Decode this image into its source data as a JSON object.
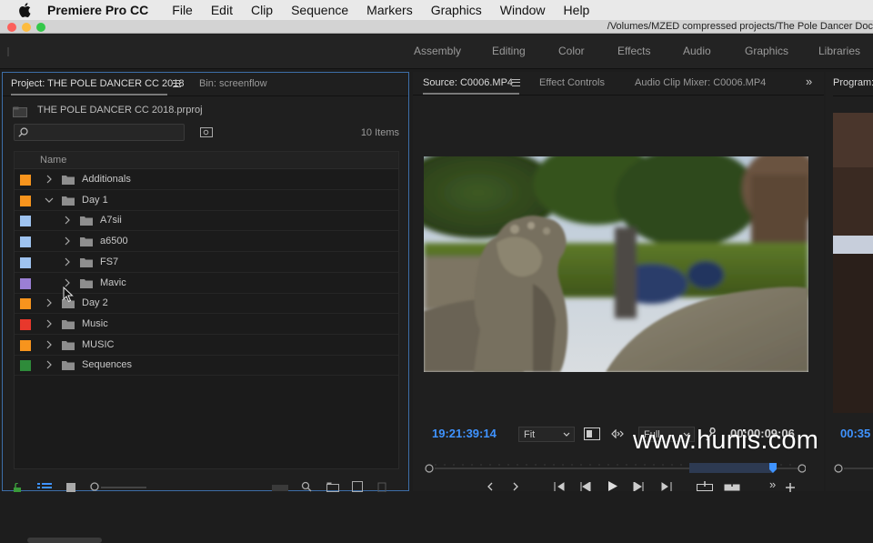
{
  "menubar": {
    "app_name": "Premiere Pro CC",
    "items": [
      "File",
      "Edit",
      "Clip",
      "Sequence",
      "Markers",
      "Graphics",
      "Window",
      "Help"
    ]
  },
  "window": {
    "title": "/Volumes/MZED compressed projects/The Pole Dancer Doc"
  },
  "workspaces": [
    "Assembly",
    "Editing",
    "Color",
    "Effects",
    "Audio",
    "Graphics",
    "Libraries"
  ],
  "project_panel": {
    "tab_active": "Project: THE POLE DANCER CC 2018",
    "tab_bin": "Bin: screenflow",
    "project_file": "THE POLE DANCER CC 2018.prproj",
    "search_value": "",
    "items_count": "10 Items",
    "column_name": "Name",
    "rows": [
      {
        "label": "Additionals",
        "color": "#f7941d",
        "expanded": false,
        "indent": 0
      },
      {
        "label": "Day 1",
        "color": "#f7941d",
        "expanded": true,
        "indent": 0
      },
      {
        "label": "A7sii",
        "color": "#9ec3f0",
        "expanded": false,
        "indent": 1
      },
      {
        "label": "a6500",
        "color": "#9ec3f0",
        "expanded": false,
        "indent": 1
      },
      {
        "label": "FS7",
        "color": "#9ec3f0",
        "expanded": false,
        "indent": 1
      },
      {
        "label": "Mavic",
        "color": "#9b7fd4",
        "expanded": false,
        "indent": 1
      },
      {
        "label": "Day 2",
        "color": "#f7941d",
        "expanded": false,
        "indent": 0
      },
      {
        "label": "Music",
        "color": "#e8382c",
        "expanded": false,
        "indent": 0
      },
      {
        "label": "MUSIC",
        "color": "#f7941d",
        "expanded": false,
        "indent": 0
      },
      {
        "label": "Sequences",
        "color": "#2e8b3a",
        "expanded": false,
        "indent": 0
      }
    ]
  },
  "source_panel": {
    "tab_active": "Source: C0006.MP4",
    "tab_effects": "Effect Controls",
    "tab_mixer": "Audio Clip Mixer: C0006.MP4",
    "timecode_in": "19:21:39:14",
    "zoom_value": "Fit",
    "resolution_value": "Full",
    "timecode_duration": "00:00:09:06"
  },
  "program_panel": {
    "tab": "Program:",
    "timecode": "00:35"
  },
  "watermark": "www.hunis.com",
  "colors": {
    "accent_blue": "#3f93ff",
    "panel_focus_border": "#3d6ea8"
  }
}
